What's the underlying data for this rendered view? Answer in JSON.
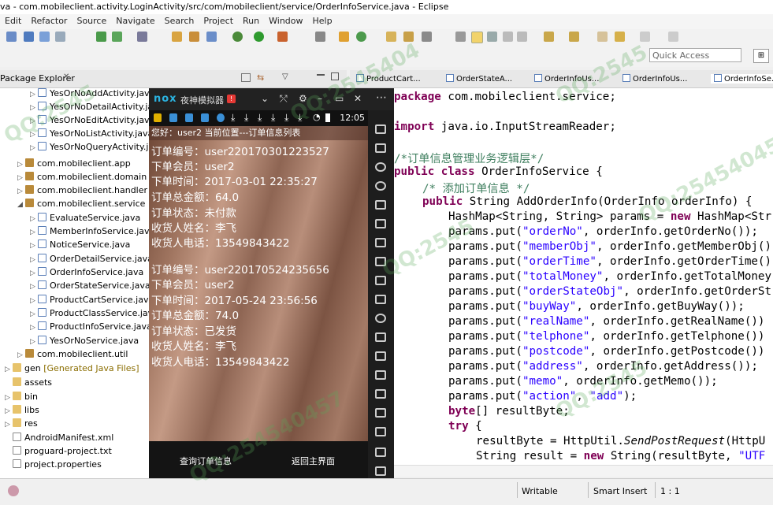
{
  "window": {
    "title": "va - com.mobileclient.activity.LoginActivity/src/com/mobileclient/service/OrderInfoService.java - Eclipse"
  },
  "menu": [
    "Edit",
    "Refactor",
    "Source",
    "Navigate",
    "Search",
    "Project",
    "Run",
    "Window",
    "Help"
  ],
  "toolbar": {
    "quick_access_placeholder": "Quick Access"
  },
  "package_explorer": {
    "title": "Package Explorer",
    "items": [
      "YesOrNoAddActivity.java",
      "YesOrNoDetailActivity.java",
      "YesOrNoEditActivity.java",
      "YesOrNoListActivity.java",
      "YesOrNoQueryActivity.java",
      "com.mobileclient.app",
      "com.mobileclient.domain",
      "com.mobileclient.handler",
      "com.mobileclient.service",
      "EvaluateService.java",
      "MemberInfoService.java",
      "NoticeService.java",
      "OrderDetailService.java",
      "OrderInfoService.java",
      "OrderStateService.java",
      "ProductCartService.java",
      "ProductClassService.java",
      "ProductInfoService.java",
      "YesOrNoService.java",
      "com.mobileclient.util",
      "gen",
      "assets",
      "bin",
      "libs",
      "res",
      "AndroidManifest.xml",
      "proguard-project.txt",
      "project.properties"
    ],
    "gen_suffix": "[Generated Java Files]"
  },
  "editor": {
    "tabs": [
      "ProductCart...",
      "OrderStateA...",
      "OrderInfoUs...",
      "OrderInfoUs...",
      "OrderInfoSe..."
    ],
    "line_number": "1"
  },
  "status": {
    "mode": "Writable",
    "insert": "Smart Insert",
    "position": "1 : 1"
  },
  "emulator": {
    "logo": "nox",
    "name": "夜神模拟器",
    "badge": "!",
    "clock": "12:05",
    "header": "您好：user2  当前位置---订单信息列表",
    "orders": [
      {
        "order_no": "订单编号：user220170301223527",
        "member": "下单会员：user2",
        "time": "下单时间：2017-03-01 22:35:27",
        "total": "订单总金额：64.0",
        "state": "订单状态：未付款",
        "name": "收货人姓名：李飞",
        "phone": "收货人电话：13549843422"
      },
      {
        "order_no": "订单编号：user220170524235656",
        "member": "下单会员：user2",
        "time": "下单时间：2017-05-24 23:56:56",
        "total": "订单总金额：74.0",
        "state": "订单状态：已发货",
        "name": "收货人姓名：李飞",
        "phone": "收货人电话：13549843422"
      }
    ],
    "btn_query": "查询订单信息",
    "btn_home": "返回主界面"
  },
  "code": {
    "l_package": "com.mobileclient.service;",
    "l_import": "java.io.InputStreamReader;",
    "l_comment_class": "/*订单信息管理业务逻辑层*/",
    "l_class_name": "OrderInfoService {",
    "l_comment_add": "/* 添加订单信息 */",
    "l_method_sig": "String AddOrderInfo(OrderInfo orderInfo) {",
    "l_hashmap_a": "HashMap<String, String> params = ",
    "l_hashmap_b": "HashMap<Str",
    "puts": [
      {
        "key": "\"orderNo\"",
        "rest": ", orderInfo.getOrderNo());"
      },
      {
        "key": "\"memberObj\"",
        "rest": ", orderInfo.getMemberObj()"
      },
      {
        "key": "\"orderTime\"",
        "rest": ", orderInfo.getOrderTime()"
      },
      {
        "key": "\"totalMoney\"",
        "rest": ", orderInfo.getTotalMoney"
      },
      {
        "key": "\"orderStateObj\"",
        "rest": ", orderInfo.getOrderSt"
      },
      {
        "key": "\"buyWay\"",
        "rest": ", orderInfo.getBuyWay());"
      },
      {
        "key": "\"realName\"",
        "rest": ", orderInfo.getRealName())"
      },
      {
        "key": "\"telphone\"",
        "rest": ", orderInfo.getTelphone())"
      },
      {
        "key": "\"postcode\"",
        "rest": ", orderInfo.getPostcode())"
      },
      {
        "key": "\"address\"",
        "rest": ", orderInfo.getAddress());"
      },
      {
        "key": "\"memo\"",
        "rest": ", orderInfo.getMemo());"
      },
      {
        "key": "\"action\"",
        "rest": ", "
      }
    ],
    "action_value": "\"add\"",
    "l_bytes": "[] resultByte;",
    "l_try": "try",
    "l_try_brace": " {",
    "l_result_a": "resultByte = HttpUtil.",
    "l_result_b": "SendPostRequest",
    "l_result_c": "(HttpU",
    "l_string_a": "String result = ",
    "l_string_b": " String(resultByte, ",
    "l_string_c": "\"UTF"
  },
  "colors": {
    "keyword": "#7f0055",
    "string": "#2a00ff",
    "comment": "#3f7f5f"
  }
}
